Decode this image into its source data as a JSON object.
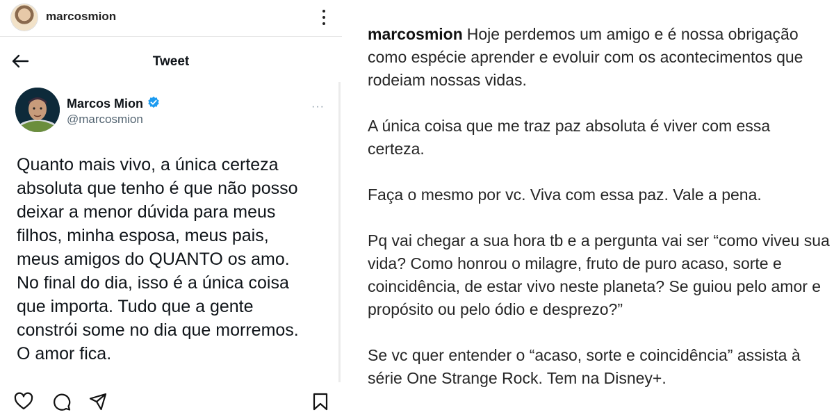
{
  "instagram": {
    "username": "marcosmion",
    "caption_paragraphs": [
      "Hoje perdemos um amigo e é nossa obrigação como espécie aprender e evoluir com os acontecimentos que rodeiam nossas vidas.",
      "A única coisa que me traz paz absoluta é viver com essa certeza.",
      "Faça o mesmo por vc. Viva com essa paz. Vale a pena.",
      "Pq vai chegar a sua hora tb e a pergunta vai ser “como viveu sua vida? Como honrou o milagre, fruto de puro acaso, sorte e coincidência, de estar vivo neste planeta? Se guiou pelo amor e propósito ou pelo ódio e desprezo?”",
      "Se vc quer entender o “acaso, sorte e coincidência” assista à série One Strange Rock. Tem na Disney+."
    ]
  },
  "tweet": {
    "header_title": "Tweet",
    "author_name": "Marcos Mion",
    "author_handle": "@marcosmion",
    "more": "···",
    "text": "Quanto mais vivo, a única certeza absoluta que tenho é que não posso deixar a menor dúvida para meus filhos, minha esposa, meus pais, meus amigos do QUANTO os amo. No final do dia, isso é a única coisa que importa. Tudo que a gente constrói some no dia que morremos. O amor fica."
  },
  "icons": {
    "back": "arrow-left-icon",
    "verified": "verified-badge-icon",
    "like": "heart-icon",
    "comment": "comment-icon",
    "share": "send-icon",
    "save": "bookmark-icon",
    "more": "more-vertical-icon"
  },
  "colors": {
    "verified_blue": "#1d9bf0",
    "text_primary": "#0f1419",
    "text_secondary": "#536471"
  }
}
